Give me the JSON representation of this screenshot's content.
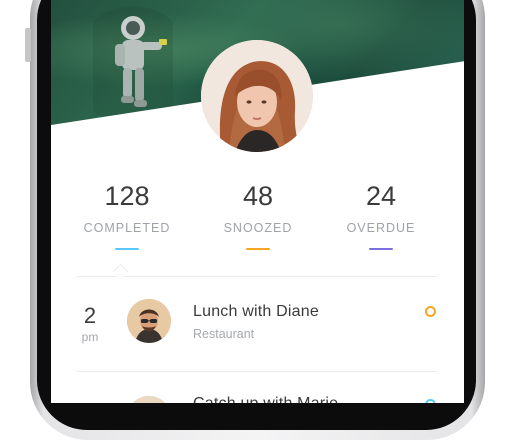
{
  "stats": [
    {
      "value": "128",
      "label": "COMPLETED",
      "color": "#5ac8fa"
    },
    {
      "value": "48",
      "label": "SNOOZED",
      "color": "#f5a623"
    },
    {
      "value": "24",
      "label": "OVERDUE",
      "color": "#7b6fe0"
    }
  ],
  "events": [
    {
      "hour": "2",
      "ampm": "pm",
      "title": "Lunch with Diane",
      "subtitle": "Restaurant",
      "dot_color": "#f5a623"
    },
    {
      "hour": "",
      "ampm": "",
      "title": "Catch up with Marie",
      "subtitle": "",
      "dot_color": "#5ac8fa"
    }
  ]
}
